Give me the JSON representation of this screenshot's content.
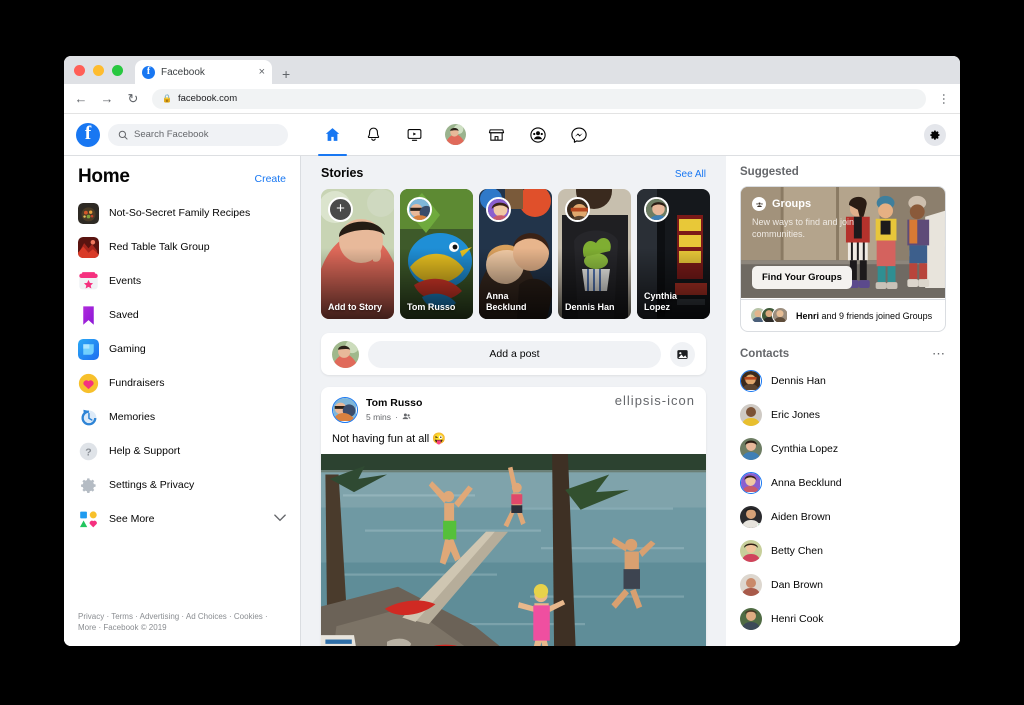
{
  "browser": {
    "tab_title": "Facebook",
    "tab_favicon": "facebook-icon",
    "tab_close": "×",
    "new_tab": "+",
    "back": "←",
    "forward": "→",
    "reload": "↻",
    "lock_icon": "lock-icon",
    "url": "facebook.com",
    "menu": "⋮"
  },
  "header": {
    "logo": "facebook-logo",
    "search": {
      "placeholder": "Search Facebook",
      "icon": "search-icon"
    },
    "nav": [
      {
        "name": "home",
        "icon": "home-icon",
        "active": true
      },
      {
        "name": "notifications",
        "icon": "bell-icon",
        "active": false
      },
      {
        "name": "watch",
        "icon": "video-icon",
        "active": false
      },
      {
        "name": "profile",
        "icon": "avatar-icon",
        "active": false
      },
      {
        "name": "marketplace",
        "icon": "store-icon",
        "active": false
      },
      {
        "name": "groups",
        "icon": "groups-icon",
        "active": false
      },
      {
        "name": "messenger",
        "icon": "messenger-icon",
        "active": false
      }
    ],
    "settings_icon": "gear-icon"
  },
  "sidebar": {
    "title": "Home",
    "create_label": "Create",
    "items": [
      {
        "label": "Not-So-Secret Family Recipes",
        "icon": "group-photo-icon"
      },
      {
        "label": "Red Table Talk Group",
        "icon": "group-photo-icon"
      },
      {
        "label": "Events",
        "icon": "events-icon"
      },
      {
        "label": "Saved",
        "icon": "saved-bookmark-icon"
      },
      {
        "label": "Gaming",
        "icon": "gaming-icon"
      },
      {
        "label": "Fundraisers",
        "icon": "fundraisers-heart-icon"
      },
      {
        "label": "Memories",
        "icon": "memories-clock-icon"
      },
      {
        "label": "Help & Support",
        "icon": "help-question-icon"
      },
      {
        "label": "Settings & Privacy",
        "icon": "settings-gear-icon"
      },
      {
        "label": "See More",
        "icon": "see-more-shapes-icon",
        "chevron": "⌄"
      }
    ],
    "footer_line1": "Privacy · Terms · Advertising · Ad Choices · Cookies ·",
    "footer_line2": "More · Facebook © 2019"
  },
  "stories": {
    "title": "Stories",
    "see_all": "See All",
    "cards": [
      {
        "name": "Add to Story",
        "is_add": true,
        "plus": "+"
      },
      {
        "name": "Tom Russo",
        "is_add": false
      },
      {
        "name": "Anna Becklund",
        "is_add": false
      },
      {
        "name": "Dennis Han",
        "is_add": false
      },
      {
        "name": "Cynthia Lopez",
        "is_add": false
      }
    ]
  },
  "composer": {
    "placeholder": "Add a post",
    "photo_icon": "photo-icon",
    "avatar": "user-avatar"
  },
  "post": {
    "author": "Tom Russo",
    "time": "5 mins",
    "audience_icon": "friends-icon",
    "more_icon": "ellipsis-icon",
    "text": "Not having fun at all 😜",
    "image_alt": "people jumping off a dock into a lake"
  },
  "suggested": {
    "title": "Suggested",
    "card": {
      "badge": "Groups",
      "badge_icon": "groups-icon",
      "description": "New ways to find and join communities.",
      "button": "Find Your Groups",
      "footer_name": "Henri",
      "footer_rest": " and 9 friends joined Groups"
    }
  },
  "contacts": {
    "title": "Contacts",
    "menu_icon": "ellipsis-icon",
    "list": [
      {
        "name": "Dennis Han",
        "ring": true,
        "online": false
      },
      {
        "name": "Eric Jones",
        "ring": false,
        "online": false
      },
      {
        "name": "Cynthia Lopez",
        "ring": false,
        "online": false
      },
      {
        "name": "Anna Becklund",
        "ring": true,
        "online": false
      },
      {
        "name": "Aiden Brown",
        "ring": false,
        "online": true
      },
      {
        "name": "Betty Chen",
        "ring": false,
        "online": false
      },
      {
        "name": "Dan Brown",
        "ring": false,
        "online": false
      },
      {
        "name": "Henri Cook",
        "ring": false,
        "online": false
      }
    ]
  },
  "colors": {
    "brand_blue": "#1877f2",
    "bg_gray": "#f0f2f5",
    "text_primary": "#050505",
    "text_secondary": "#65676b",
    "online_green": "#31a24c"
  }
}
